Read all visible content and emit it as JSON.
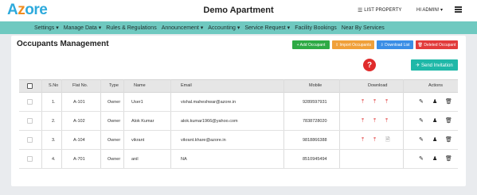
{
  "app": {
    "logo_first": "A",
    "logo_z": "z",
    "logo_rest": "ore",
    "title": "Demo Apartment",
    "list_property": "LIST PROPERTY",
    "user_menu": "HI ADMIN! ▾"
  },
  "nav": {
    "items": [
      "Settings ▾",
      "Manage Data ▾",
      "Rules & Regulations",
      "Announcement ▾",
      "Accounting ▾",
      "Service Request ▾",
      "Facility Bookings",
      "Near By Services"
    ]
  },
  "page": {
    "heading": "Occupants Management",
    "buttons": {
      "add": "+ Add Occupant",
      "import": "⇪ Import Occupants",
      "download": "⇩ Download List",
      "deleted": "🗑 Deleted Occupant",
      "invite": "✈ Send Invitation"
    },
    "help": "?"
  },
  "table": {
    "headers": {
      "sno": "S.No",
      "flat": "Flat No.",
      "type": "Type",
      "name": "Name",
      "email": "Email",
      "mobile": "Mobile",
      "download": "Download",
      "actions": "Actions"
    },
    "rows": [
      {
        "sno": "1.",
        "flat": "A-101",
        "type": "Owner",
        "name": "User1",
        "email": "vishal.maheshwar@azore.in",
        "mobile": "9289597931"
      },
      {
        "sno": "2.",
        "flat": "A-102",
        "type": "Owner",
        "name": "Alok Kumar",
        "email": "alok.kumar1966@yahoo.com",
        "mobile": "7838728020"
      },
      {
        "sno": "3.",
        "flat": "A-104",
        "type": "Owner",
        "name": "vikrant",
        "email": "vikrant.khare@azore.in",
        "mobile": "9818866388"
      },
      {
        "sno": "4.",
        "flat": "A-701",
        "type": "Owner",
        "name": "anil",
        "email": "NA",
        "mobile": "8510945494"
      }
    ]
  },
  "icons": {
    "list": "☰",
    "upload": "⤒",
    "file": "🗎",
    "edit": "✎",
    "person": "♟",
    "trash": "🗑"
  },
  "colors": {
    "nav_bg": "#6fc9c0",
    "add": "#2eaa45",
    "import": "#f0a03a",
    "download": "#3a8ee6",
    "deleted": "#e23b3b",
    "invite": "#1fb8a8"
  }
}
